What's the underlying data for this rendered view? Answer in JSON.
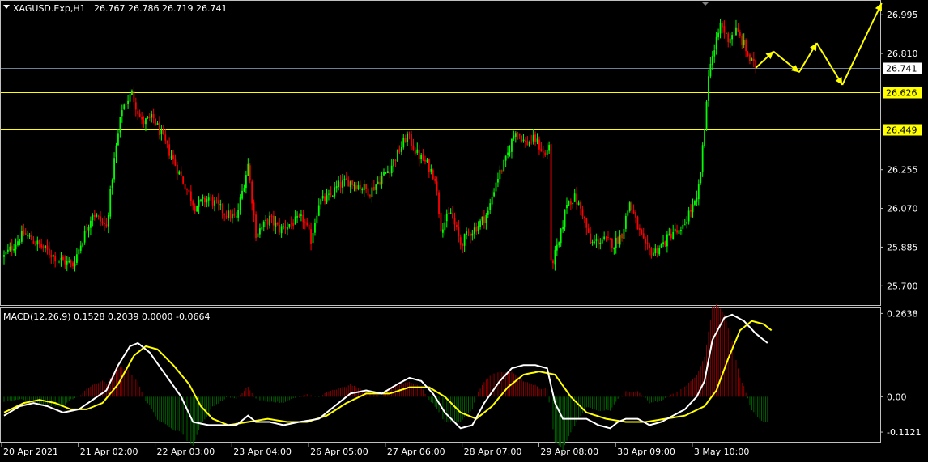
{
  "header": {
    "symbol": "XAGUSD.Exp,H1",
    "ohlc": "26.767 26.786 26.719 26.741"
  },
  "macd_header": "MACD(12,26,9) 0.1528 0.2039 0.0000 -0.0664",
  "colors": {
    "background": "#000000",
    "bull": "#00ff00",
    "bear": "#ff0000",
    "level_line": "#ffff00",
    "bid_line": "#708090",
    "arrow": "#ffff00",
    "macd_line": "#ffffff",
    "signal_line": "#ffff00",
    "hist_pos": "#8b0000",
    "hist_neg": "#006400",
    "axis_text": "#ffffff",
    "frame": "#c0c0c0"
  },
  "chart_data": [
    {
      "type": "candlestick",
      "symbol": "XAGUSD.Exp",
      "timeframe": "H1",
      "ylim": [
        25.62,
        27.05
      ],
      "y_ticks": [
        "26.995",
        "26.810",
        "26.255",
        "26.070",
        "25.885",
        "25.700"
      ],
      "x_ticks": [
        "20 Apr 2021",
        "21 Apr 02:00",
        "22 Apr 03:00",
        "23 Apr 04:00",
        "26 Apr 05:00",
        "27 Apr 06:00",
        "28 Apr 07:00",
        "29 Apr 08:00",
        "30 Apr 09:00",
        "3 May 10:00"
      ],
      "price_key_points": [
        [
          0,
          25.84
        ],
        [
          10,
          25.95
        ],
        [
          20,
          25.88
        ],
        [
          27,
          25.83
        ],
        [
          35,
          25.8
        ],
        [
          45,
          26.05
        ],
        [
          52,
          25.98
        ],
        [
          56,
          26.3
        ],
        [
          60,
          26.55
        ],
        [
          65,
          26.62
        ],
        [
          70,
          26.48
        ],
        [
          76,
          26.5
        ],
        [
          82,
          26.38
        ],
        [
          90,
          26.22
        ],
        [
          97,
          26.08
        ],
        [
          104,
          26.12
        ],
        [
          112,
          26.05
        ],
        [
          118,
          26.02
        ],
        [
          124,
          26.28
        ],
        [
          128,
          25.95
        ],
        [
          135,
          26.02
        ],
        [
          140,
          25.97
        ],
        [
          146,
          26.0
        ],
        [
          152,
          26.02
        ],
        [
          156,
          25.92
        ],
        [
          160,
          26.1
        ],
        [
          165,
          26.12
        ],
        [
          170,
          26.18
        ],
        [
          175,
          26.2
        ],
        [
          180,
          26.18
        ],
        [
          186,
          26.15
        ],
        [
          192,
          26.22
        ],
        [
          196,
          26.26
        ],
        [
          200,
          26.33
        ],
        [
          205,
          26.42
        ],
        [
          210,
          26.33
        ],
        [
          215,
          26.28
        ],
        [
          219,
          26.22
        ],
        [
          222,
          25.98
        ],
        [
          227,
          26.05
        ],
        [
          232,
          25.9
        ],
        [
          236,
          25.95
        ],
        [
          240,
          25.98
        ],
        [
          246,
          26.05
        ],
        [
          250,
          26.2
        ],
        [
          255,
          26.3
        ],
        [
          260,
          26.45
        ],
        [
          265,
          26.38
        ],
        [
          270,
          26.4
        ],
        [
          275,
          26.32
        ],
        [
          277,
          26.38
        ],
        [
          278,
          25.8
        ],
        [
          282,
          25.9
        ],
        [
          286,
          26.1
        ],
        [
          290,
          26.12
        ],
        [
          294,
          26.05
        ],
        [
          298,
          25.9
        ],
        [
          304,
          25.92
        ],
        [
          310,
          25.9
        ],
        [
          314,
          25.95
        ],
        [
          318,
          26.1
        ],
        [
          322,
          25.98
        ],
        [
          326,
          25.88
        ],
        [
          330,
          25.86
        ],
        [
          335,
          25.9
        ],
        [
          340,
          25.96
        ],
        [
          344,
          25.95
        ],
        [
          348,
          26.05
        ],
        [
          352,
          26.1
        ],
        [
          354,
          26.25
        ],
        [
          356,
          26.45
        ],
        [
          357,
          26.6
        ],
        [
          359,
          26.78
        ],
        [
          361,
          26.82
        ],
        [
          364,
          26.95
        ],
        [
          368,
          26.88
        ],
        [
          372,
          26.92
        ],
        [
          376,
          26.85
        ],
        [
          379,
          26.78
        ],
        [
          382,
          26.741
        ]
      ],
      "levels": [
        {
          "label": "26.626",
          "value": 26.626,
          "style": "highlight"
        },
        {
          "label": "26.449",
          "value": 26.449,
          "style": "highlight"
        },
        {
          "label": "26.741",
          "value": 26.741,
          "style": "bid"
        }
      ],
      "forecast_path": [
        [
          382,
          26.741
        ],
        [
          391,
          26.82
        ],
        [
          404,
          26.72
        ],
        [
          413,
          26.86
        ],
        [
          426,
          26.66
        ],
        [
          446,
          27.05
        ]
      ]
    },
    {
      "type": "macd",
      "params": "12,26,9",
      "values": {
        "macd": 0.1528,
        "signal": 0.2039,
        "third": 0.0,
        "hist": -0.0664
      },
      "ylim": [
        -0.135,
        0.275
      ],
      "y_ticks": [
        "0.2638",
        "0.00",
        "-0.1121"
      ],
      "macd_key_points": [
        [
          0,
          -0.06
        ],
        [
          8,
          -0.03
        ],
        [
          15,
          -0.02
        ],
        [
          22,
          -0.03
        ],
        [
          30,
          -0.05
        ],
        [
          38,
          -0.04
        ],
        [
          45,
          -0.01
        ],
        [
          52,
          0.02
        ],
        [
          58,
          0.1
        ],
        [
          64,
          0.16
        ],
        [
          68,
          0.17
        ],
        [
          74,
          0.14
        ],
        [
          82,
          0.07
        ],
        [
          90,
          0.0
        ],
        [
          96,
          -0.08
        ],
        [
          104,
          -0.09
        ],
        [
          110,
          -0.09
        ],
        [
          118,
          -0.09
        ],
        [
          124,
          -0.06
        ],
        [
          128,
          -0.08
        ],
        [
          135,
          -0.08
        ],
        [
          142,
          -0.09
        ],
        [
          150,
          -0.08
        ],
        [
          160,
          -0.07
        ],
        [
          168,
          -0.03
        ],
        [
          176,
          0.01
        ],
        [
          184,
          0.02
        ],
        [
          192,
          0.01
        ],
        [
          200,
          0.04
        ],
        [
          206,
          0.06
        ],
        [
          212,
          0.05
        ],
        [
          218,
          0.01
        ],
        [
          224,
          -0.05
        ],
        [
          232,
          -0.1
        ],
        [
          238,
          -0.09
        ],
        [
          244,
          -0.02
        ],
        [
          252,
          0.05
        ],
        [
          258,
          0.09
        ],
        [
          264,
          0.1
        ],
        [
          270,
          0.1
        ],
        [
          276,
          0.09
        ],
        [
          280,
          -0.02
        ],
        [
          284,
          -0.07
        ],
        [
          290,
          -0.07
        ],
        [
          296,
          -0.07
        ],
        [
          302,
          -0.09
        ],
        [
          308,
          -0.1
        ],
        [
          312,
          -0.08
        ],
        [
          316,
          -0.07
        ],
        [
          322,
          -0.07
        ],
        [
          328,
          -0.09
        ],
        [
          334,
          -0.08
        ],
        [
          340,
          -0.06
        ],
        [
          346,
          -0.04
        ],
        [
          352,
          0.0
        ],
        [
          356,
          0.05
        ],
        [
          360,
          0.18
        ],
        [
          366,
          0.25
        ],
        [
          370,
          0.26
        ],
        [
          376,
          0.24
        ],
        [
          382,
          0.2
        ],
        [
          388,
          0.17
        ]
      ],
      "signal_key_points": [
        [
          0,
          -0.05
        ],
        [
          10,
          -0.02
        ],
        [
          18,
          -0.01
        ],
        [
          26,
          -0.02
        ],
        [
          34,
          -0.04
        ],
        [
          42,
          -0.04
        ],
        [
          50,
          -0.02
        ],
        [
          58,
          0.04
        ],
        [
          66,
          0.13
        ],
        [
          72,
          0.16
        ],
        [
          78,
          0.15
        ],
        [
          86,
          0.1
        ],
        [
          94,
          0.04
        ],
        [
          100,
          -0.03
        ],
        [
          106,
          -0.07
        ],
        [
          114,
          -0.09
        ],
        [
          124,
          -0.08
        ],
        [
          134,
          -0.07
        ],
        [
          144,
          -0.08
        ],
        [
          154,
          -0.08
        ],
        [
          164,
          -0.06
        ],
        [
          174,
          -0.02
        ],
        [
          184,
          0.01
        ],
        [
          196,
          0.01
        ],
        [
          206,
          0.03
        ],
        [
          216,
          0.03
        ],
        [
          224,
          0.0
        ],
        [
          232,
          -0.05
        ],
        [
          240,
          -0.07
        ],
        [
          248,
          -0.03
        ],
        [
          256,
          0.03
        ],
        [
          264,
          0.07
        ],
        [
          272,
          0.08
        ],
        [
          280,
          0.07
        ],
        [
          288,
          0.0
        ],
        [
          296,
          -0.05
        ],
        [
          306,
          -0.07
        ],
        [
          316,
          -0.08
        ],
        [
          326,
          -0.08
        ],
        [
          336,
          -0.07
        ],
        [
          346,
          -0.06
        ],
        [
          356,
          -0.03
        ],
        [
          362,
          0.02
        ],
        [
          368,
          0.12
        ],
        [
          374,
          0.21
        ],
        [
          380,
          0.24
        ],
        [
          386,
          0.23
        ],
        [
          390,
          0.21
        ]
      ]
    }
  ]
}
